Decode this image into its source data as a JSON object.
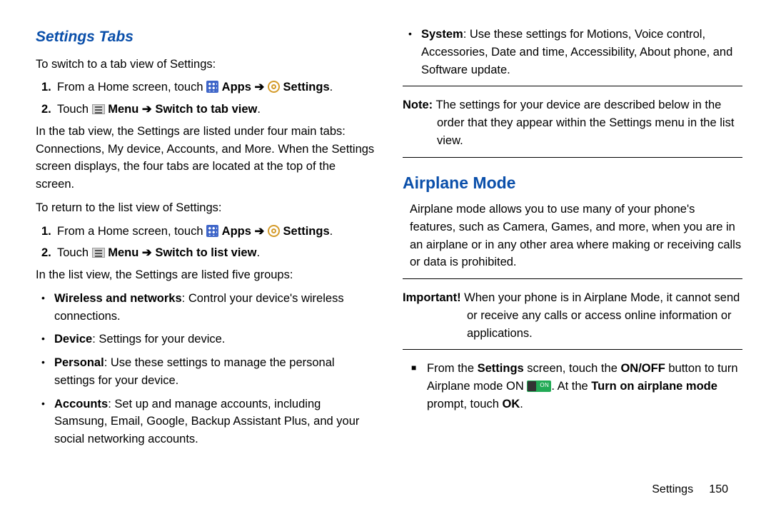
{
  "col1": {
    "heading": "Settings Tabs",
    "p1": "To switch to a tab view of Settings:",
    "step1_a": "From a Home screen, touch ",
    "apps": "Apps",
    "arrow": "➔",
    "settings": "Settings",
    "period": ".",
    "step2_a": "Touch ",
    "menu": "Menu",
    "switch_tab": "Switch to tab view",
    "p2": "In the tab view, the Settings are listed under four main tabs: Connections, My device, Accounts, and More. When the Settings screen displays, the four tabs are located at the top of the screen.",
    "p3": "To return to the list view of Settings:",
    "switch_list": "Switch to list view",
    "p4": "In the list view, the Settings are listed five groups:",
    "b1_label": "Wireless and networks",
    "b1_text": ": Control your device's wireless connections.",
    "b2_label": "Device",
    "b2_text": ": Settings for your device.",
    "b3_label": "Personal",
    "b3_text": ": Use these settings to manage the personal settings for your device.",
    "b4_label": "Accounts",
    "b4_text": ": Set up and manage accounts, including Samsung, Email, Google, Backup Assistant Plus, and your social networking accounts."
  },
  "col2": {
    "b5_label": "System",
    "b5_text": ": Use these settings for Motions, Voice control, Accessories, Date and time, Accessibility, About phone, and Software update.",
    "note_label": "Note:",
    "note_text": " The settings for your device are described below in the order that they appear within the Settings menu in the list view.",
    "heading": "Airplane Mode",
    "p1": "Airplane mode allows you to use many of your phone's features, such as Camera, Games, and more, when you are in an airplane or in any other area where making or receiving calls or data is prohibited.",
    "imp_label": "Important!",
    "imp_text": " When your phone is in Airplane Mode, it cannot send or receive any calls or access online information or applications.",
    "sq_a": "From the ",
    "sq_b": "Settings",
    "sq_c": " screen, touch the ",
    "sq_d": "ON/OFF",
    "sq_e": " button to turn Airplane mode ON ",
    "sq_f": ". At the ",
    "sq_g": "Turn on airplane mode",
    "sq_h": " prompt, touch ",
    "sq_i": "OK",
    "footer_label": "Settings",
    "footer_page": "150"
  }
}
